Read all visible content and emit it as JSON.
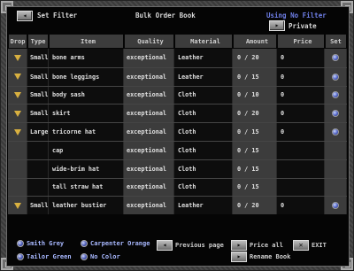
{
  "header": {
    "set_filter_label": "Set Filter",
    "title": "Bulk Order Book",
    "filter_status": "Using No Filter",
    "private_label": "Private"
  },
  "columns": [
    "Drop",
    "Type",
    "Item",
    "Quality",
    "Material",
    "Amount",
    "Price",
    "Set"
  ],
  "rows": [
    {
      "type": "Small",
      "item": "bone arms",
      "quality": "exceptional",
      "material": "Leather",
      "amount": "0 / 20",
      "price": "0",
      "drop": true,
      "set": true
    },
    {
      "type": "Small",
      "item": "bone leggings",
      "quality": "exceptional",
      "material": "Leather",
      "amount": "0 / 15",
      "price": "0",
      "drop": true,
      "set": true
    },
    {
      "type": "Small",
      "item": "body sash",
      "quality": "exceptional",
      "material": "Cloth",
      "amount": "0 / 10",
      "price": "0",
      "drop": true,
      "set": true
    },
    {
      "type": "Small",
      "item": "skirt",
      "quality": "exceptional",
      "material": "Cloth",
      "amount": "0 / 20",
      "price": "0",
      "drop": true,
      "set": true
    },
    {
      "type": "Large",
      "item": "tricorne hat",
      "quality": "exceptional",
      "material": "Cloth",
      "amount": "0 / 15",
      "price": "0",
      "drop": true,
      "set": true
    },
    {
      "type": "",
      "item": "cap",
      "quality": "exceptional",
      "material": "Cloth",
      "amount": "0 / 15",
      "price": "",
      "drop": false,
      "set": false
    },
    {
      "type": "",
      "item": "wide-brim hat",
      "quality": "exceptional",
      "material": "Cloth",
      "amount": "0 / 15",
      "price": "",
      "drop": false,
      "set": false
    },
    {
      "type": "",
      "item": "tall straw hat",
      "quality": "exceptional",
      "material": "Cloth",
      "amount": "0 / 15",
      "price": "",
      "drop": false,
      "set": false
    },
    {
      "type": "Small",
      "item": "leather bustier",
      "quality": "exceptional",
      "material": "Leather",
      "amount": "0 / 20",
      "price": "0",
      "drop": true,
      "set": true
    }
  ],
  "footer": {
    "smith_grey": "Smith Grey",
    "carpenter_orange": "Carpenter Orange",
    "tailor_green": "Tailor Green",
    "no_color": "No Color",
    "previous_page": "Previous page",
    "price_all": "Price all",
    "exit": "EXIT",
    "rename_book": "Rename Book"
  }
}
